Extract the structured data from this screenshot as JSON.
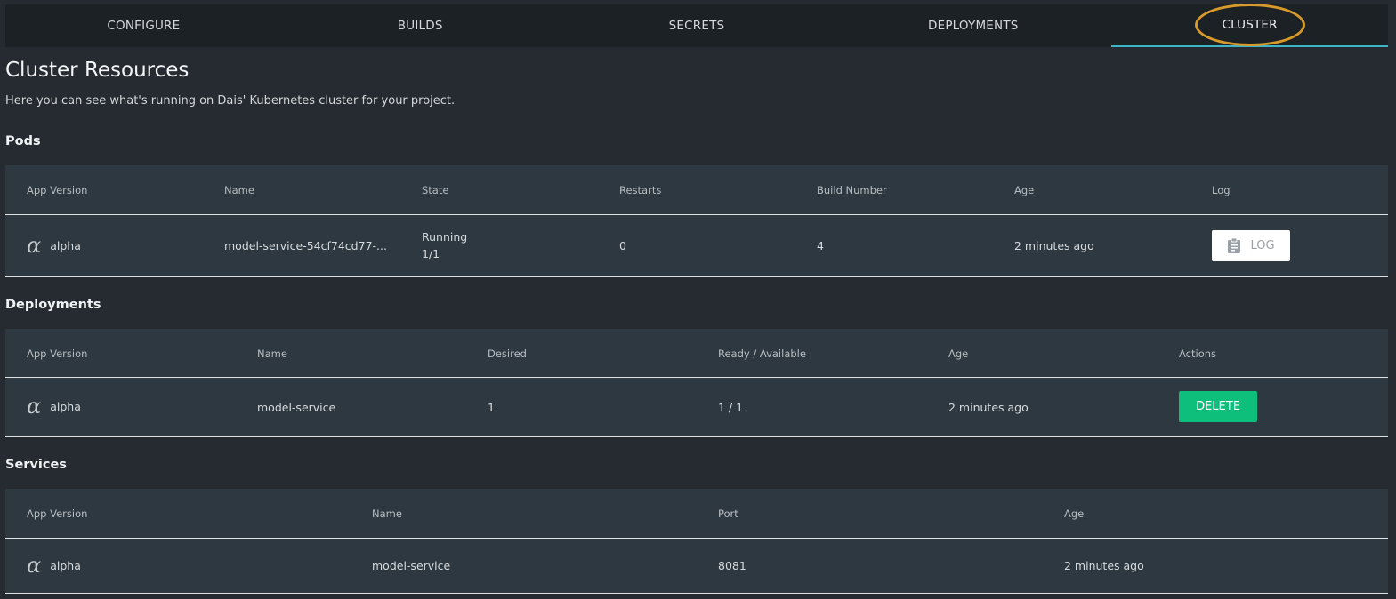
{
  "tabs": [
    {
      "label": "CONFIGURE",
      "active": false
    },
    {
      "label": "BUILDS",
      "active": false
    },
    {
      "label": "SECRETS",
      "active": false
    },
    {
      "label": "DEPLOYMENTS",
      "active": false
    },
    {
      "label": "CLUSTER",
      "active": true
    }
  ],
  "page": {
    "title": "Cluster Resources",
    "subtitle": "Here you can see what's running on Dais' Kubernetes cluster for your project."
  },
  "pods": {
    "title": "Pods",
    "headers": [
      "App Version",
      "Name",
      "State",
      "Restarts",
      "Build Number",
      "Age",
      "Log"
    ],
    "rows": [
      {
        "version_symbol": "α",
        "version": "alpha",
        "name": "model-service-54cf74cd77-...",
        "state": "Running",
        "state_count": "1/1",
        "restarts": "0",
        "build_number": "4",
        "age": "2 minutes ago",
        "log_label": "LOG"
      }
    ]
  },
  "deployments": {
    "title": "Deployments",
    "headers": [
      "App Version",
      "Name",
      "Desired",
      "Ready / Available",
      "Age",
      "Actions"
    ],
    "rows": [
      {
        "version_symbol": "α",
        "version": "alpha",
        "name": "model-service",
        "desired": "1",
        "ready": "1 / 1",
        "age": "2 minutes ago",
        "action_label": "DELETE"
      }
    ]
  },
  "services": {
    "title": "Services",
    "headers": [
      "App Version",
      "Name",
      "Port",
      "Age"
    ],
    "rows": [
      {
        "version_symbol": "α",
        "version": "alpha",
        "name": "model-service",
        "port": "8081",
        "age": "2 minutes ago"
      }
    ]
  },
  "colors": {
    "accent": "#3fb3c8",
    "highlight": "#d79a2b",
    "delete": "#0ebf7c"
  }
}
